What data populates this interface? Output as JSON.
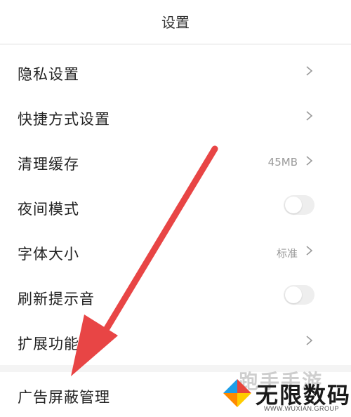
{
  "header": {
    "title": "设置"
  },
  "settings": [
    {
      "label": "隐私设置",
      "type": "chevron",
      "value": ""
    },
    {
      "label": "快捷方式设置",
      "type": "chevron",
      "value": ""
    },
    {
      "label": "清理缓存",
      "type": "chevron",
      "value": "45MB"
    },
    {
      "label": "夜间模式",
      "type": "toggle",
      "value": "off"
    },
    {
      "label": "字体大小",
      "type": "chevron",
      "value": "标准"
    },
    {
      "label": "刷新提示音",
      "type": "toggle",
      "value": "off"
    },
    {
      "label": "扩展功能",
      "type": "chevron",
      "value": ""
    }
  ],
  "ad_block": {
    "label": "广告屏蔽管理"
  },
  "annotation": {
    "arrow_color": "#e84545"
  },
  "watermark": {
    "top_text": "跑手手游",
    "main_text": "无限数码",
    "sub_text": "WWW.WUXIAN.GROUP",
    "colors": [
      "#1e9ee8",
      "#ff8a00",
      "#ffcc00",
      "#e8453c"
    ]
  }
}
